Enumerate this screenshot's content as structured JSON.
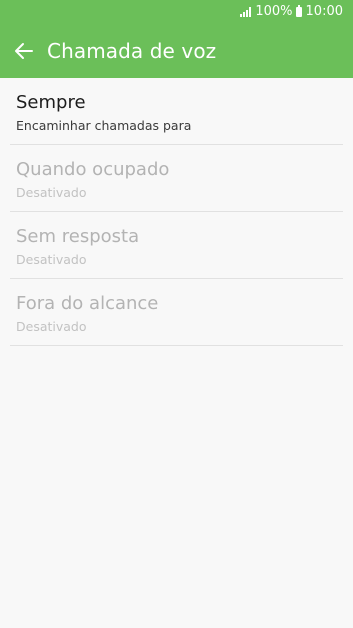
{
  "status_bar": {
    "signal_icon": "signal-bars-icon",
    "battery_level": "100%",
    "battery_icon": "battery-icon",
    "time": "10:00"
  },
  "app_bar": {
    "back_icon": "back-arrow-icon",
    "title": "Chamada de voz"
  },
  "items": [
    {
      "title": "Sempre",
      "subtitle": "Encaminhar chamadas para",
      "enabled": true
    },
    {
      "title": "Quando ocupado",
      "subtitle": "Desativado",
      "enabled": false
    },
    {
      "title": "Sem resposta",
      "subtitle": "Desativado",
      "enabled": false
    },
    {
      "title": "Fora do alcance",
      "subtitle": "Desativado",
      "enabled": false
    }
  ],
  "colors": {
    "accent": "#6bbf59",
    "background": "#f8f8f8",
    "text_primary": "#1c1c1c",
    "text_disabled": "#b3b3b3"
  }
}
